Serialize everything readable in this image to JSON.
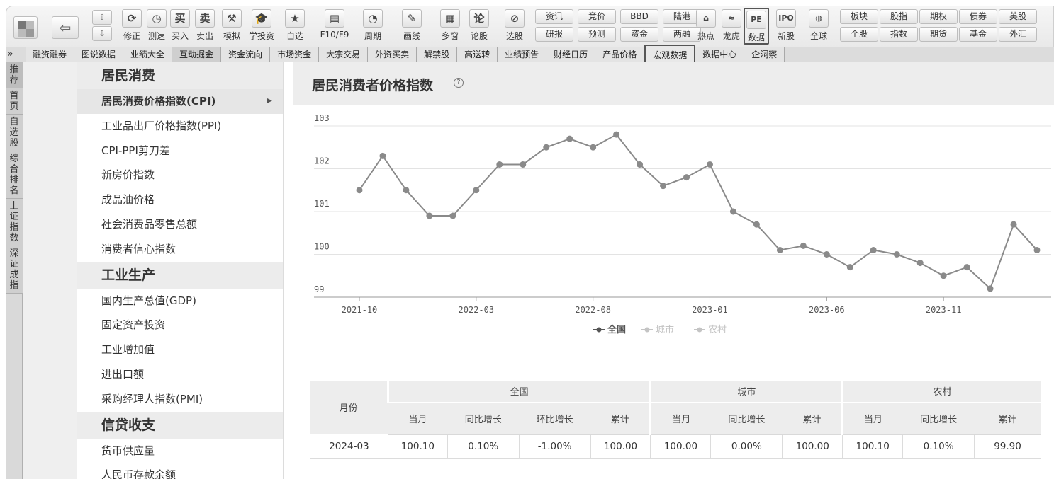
{
  "toolbar": {
    "updown": [
      "⇧",
      "⇩"
    ],
    "buttons": [
      {
        "icon": "⟳",
        "label": "修正"
      },
      {
        "icon": "◷",
        "label": "测速"
      },
      {
        "icon": "买",
        "label": "买入"
      },
      {
        "icon": "卖",
        "label": "卖出"
      },
      {
        "icon": "⚒",
        "label": "模拟"
      },
      {
        "icon": "🎓",
        "label": "学投资"
      },
      {
        "icon": "★",
        "label": "自选"
      },
      {
        "icon": "▤",
        "label": "F10/F9"
      },
      {
        "icon": "◔",
        "label": "周期"
      },
      {
        "icon": "✎",
        "label": "画线"
      },
      {
        "icon": "▦",
        "label": "多窗"
      },
      {
        "icon": "论",
        "label": "论股"
      },
      {
        "icon": "⊘",
        "label": "选股"
      }
    ],
    "pairs": [
      [
        "资讯",
        "研报"
      ],
      [
        "竞价",
        "预测"
      ],
      [
        "BBD",
        "资金"
      ],
      [
        "陆港",
        "两融"
      ]
    ],
    "buttons2": [
      {
        "icon": "⌂",
        "label": "热点"
      },
      {
        "icon": "≈",
        "label": "龙虎"
      },
      {
        "icon": "PE",
        "label": "数据"
      },
      {
        "icon": "IPO",
        "label": "新股"
      },
      {
        "icon": "◍",
        "label": "全球"
      }
    ],
    "pairs2": [
      [
        "板块",
        "个股"
      ],
      [
        "股指",
        "指数"
      ],
      [
        "期权",
        "期货"
      ],
      [
        "债券",
        "基金"
      ],
      [
        "英股",
        "外汇"
      ]
    ]
  },
  "menubar": {
    "chevron": "»",
    "items": [
      "融资融券",
      "图说数据",
      "业绩大全",
      "互动掘金",
      "资金流向",
      "市场资金",
      "大宗交易",
      "外资买卖",
      "解禁股",
      "高送转",
      "业绩预告",
      "财经日历",
      "产品价格",
      "宏观数据",
      "数据中心",
      "企洞察"
    ]
  },
  "vtabs": [
    "推荐",
    "首页",
    "自选股",
    "综合排名",
    "上证指数",
    "深证成指"
  ],
  "sidebar": {
    "groups": [
      {
        "title": "居民消费",
        "items": [
          "居民消费价格指数(CPI)",
          "工业品出厂价格指数(PPI)",
          "CPI-PPI剪刀差",
          "新房价指数",
          "成品油价格",
          "社会消费品零售总额",
          "消费者信心指数"
        ]
      },
      {
        "title": "工业生产",
        "items": [
          "国内生产总值(GDP)",
          "固定资产投资",
          "工业增加值",
          "进出口额",
          "采购经理人指数(PMI)"
        ]
      },
      {
        "title": "信贷收支",
        "items": [
          "货币供应量",
          "人民币存款余额"
        ]
      }
    ],
    "selected_arrow": "▶"
  },
  "main": {
    "title": "居民消费者价格指数",
    "help_icon": "?"
  },
  "chart_data": {
    "type": "line",
    "title": "",
    "x": [
      "2021-10",
      "2021-11",
      "2021-12",
      "2022-01",
      "2022-02",
      "2022-03",
      "2022-04",
      "2022-05",
      "2022-06",
      "2022-07",
      "2022-08",
      "2022-09",
      "2022-10",
      "2022-11",
      "2022-12",
      "2023-01",
      "2023-02",
      "2023-03",
      "2023-04",
      "2023-05",
      "2023-06",
      "2023-07",
      "2023-08",
      "2023-09",
      "2023-10",
      "2023-11",
      "2023-12",
      "2024-01",
      "2024-02",
      "2024-03"
    ],
    "xticks": [
      "2021-10",
      "2022-03",
      "2022-08",
      "2023-01",
      "2023-06",
      "2023-11"
    ],
    "yticks": [
      99,
      100,
      101,
      102,
      103
    ],
    "ylim": [
      99,
      103
    ],
    "series": [
      {
        "name": "全国",
        "values": [
          101.5,
          102.3,
          101.5,
          100.9,
          100.9,
          101.5,
          102.1,
          102.1,
          102.5,
          102.7,
          102.5,
          102.8,
          102.1,
          101.6,
          101.8,
          102.1,
          101.0,
          100.7,
          100.1,
          100.2,
          100.0,
          99.7,
          100.1,
          100.0,
          99.8,
          99.5,
          99.7,
          99.2,
          100.7,
          100.1
        ],
        "visible": true
      },
      {
        "name": "城市",
        "visible": false
      },
      {
        "name": "农村",
        "visible": false
      }
    ],
    "legend_position": "bottom-center",
    "grid": true,
    "line_color": "#8a8a8a",
    "hidden_color": "#c4c4c4"
  },
  "table": {
    "month_header": "月份",
    "groups": [
      "全国",
      "城市",
      "农村"
    ],
    "subheaders": [
      "当月",
      "同比增长",
      "环比增长",
      "累计",
      "当月",
      "同比增长",
      "累计",
      "当月",
      "同比增长",
      "累计"
    ],
    "rows": [
      [
        "2024-03",
        "100.10",
        "0.10%",
        "-1.00%",
        "100.00",
        "100.00",
        "0.00%",
        "100.00",
        "100.10",
        "0.10%",
        "99.90"
      ]
    ]
  }
}
